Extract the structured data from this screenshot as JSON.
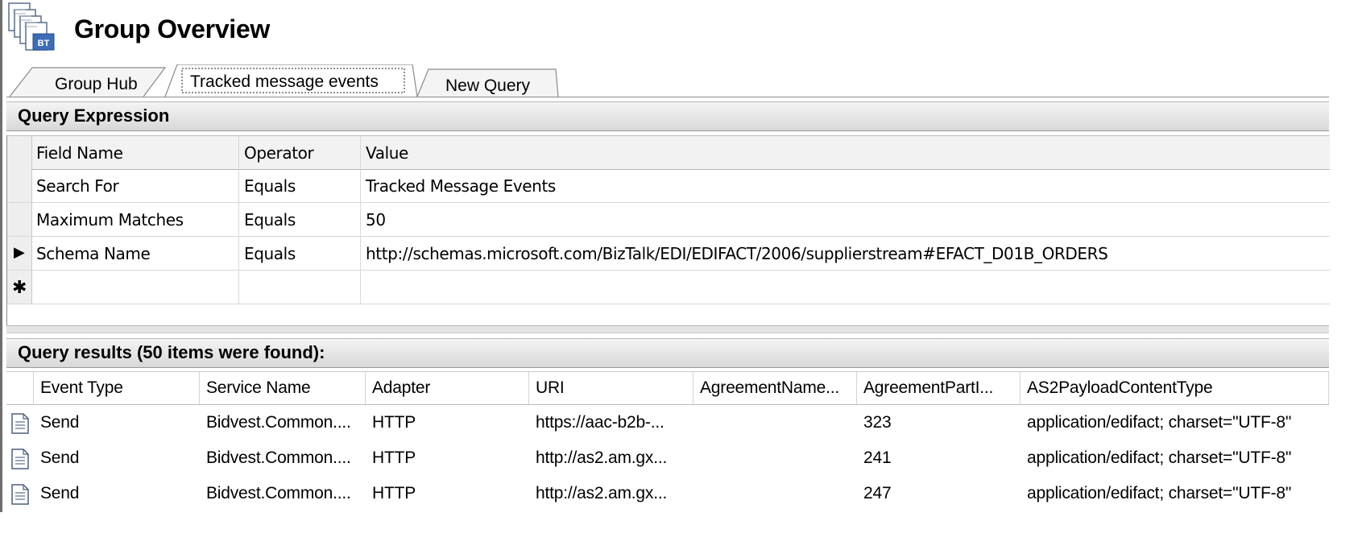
{
  "title": "Group Overview",
  "header_icon": "biztalk-group-icon",
  "header_icon_badge": "BT",
  "tabs": [
    {
      "label": "Group Hub",
      "active": false
    },
    {
      "label": "Tracked message events",
      "active": true
    },
    {
      "label": "New Query",
      "active": false
    }
  ],
  "query_expression": {
    "title": "Query Expression",
    "columns": [
      "Field Name",
      "Operator",
      "Value"
    ],
    "rows": [
      {
        "field": "Search For",
        "operator": "Equals",
        "value": "Tracked Message Events"
      },
      {
        "field": "Maximum Matches",
        "operator": "Equals",
        "value": "50"
      },
      {
        "field": "Schema Name",
        "operator": "Equals",
        "value": "http://schemas.microsoft.com/BizTalk/EDI/EDIFACT/2006/supplierstream#EFACT_D01B_ORDERS"
      }
    ],
    "current_row_marker": "▶",
    "new_row_marker": "✱"
  },
  "results": {
    "title": "Query results (50 items were found):",
    "columns": [
      "Event Type",
      "Service Name",
      "Adapter",
      "URI",
      "AgreementName...",
      "AgreementPartI...",
      "AS2PayloadContentType"
    ],
    "rows": [
      {
        "icon": "document-icon",
        "event_type": "Send",
        "service": "Bidvest.Common....",
        "adapter": "HTTP",
        "uri": "https://aac-b2b-...",
        "agreement_name": "",
        "agreement_part": "323",
        "as2_type": "application/edifact; charset=\"UTF-8\""
      },
      {
        "icon": "document-icon",
        "event_type": "Send",
        "service": "Bidvest.Common....",
        "adapter": "HTTP",
        "uri": "http://as2.am.gx...",
        "agreement_name": "",
        "agreement_part": "241",
        "as2_type": "application/edifact; charset=\"UTF-8\""
      },
      {
        "icon": "document-icon",
        "event_type": "Send",
        "service": "Bidvest.Common....",
        "adapter": "HTTP",
        "uri": "http://as2.am.gx...",
        "agreement_name": "",
        "agreement_part": "247",
        "as2_type": "application/edifact; charset=\"UTF-8\""
      }
    ]
  }
}
